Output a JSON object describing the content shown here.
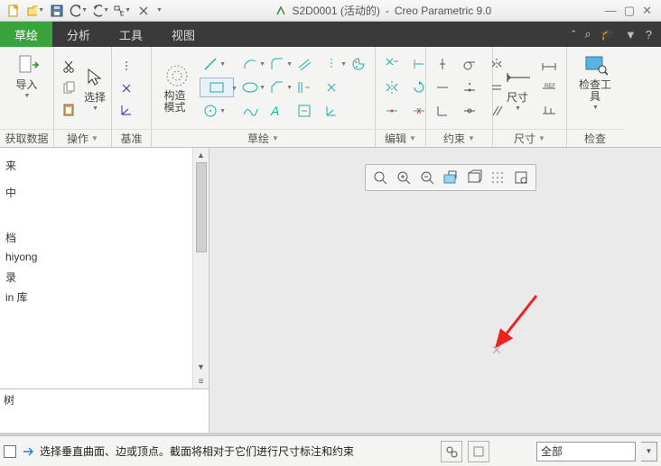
{
  "title": {
    "doc": "S2D0001 (活动的)",
    "app": "Creo Parametric 9.0"
  },
  "tabs": {
    "active": "草绘",
    "t2": "分析",
    "t3": "工具",
    "t4": "视图"
  },
  "groups": {
    "getdata": "获取数据",
    "op": "操作",
    "datum": "基准",
    "sketch": "草绘",
    "edit": "编辑",
    "constrain": "约束",
    "dim": "尺寸",
    "inspect": "检查"
  },
  "buttons": {
    "import": "导入",
    "select": "选择",
    "construct": "构造模式",
    "dim_btn": "尺寸",
    "inspect_btn": "检查工具"
  },
  "sidebar": {
    "items": [
      "来",
      "中",
      "档",
      "hiyong",
      "录",
      "in 库"
    ],
    "bottom": "树"
  },
  "statusbar": {
    "hint": "选择垂直曲面、边或顶点。截面将相对于它们进行尺寸标注和约束",
    "filter": "全部"
  }
}
